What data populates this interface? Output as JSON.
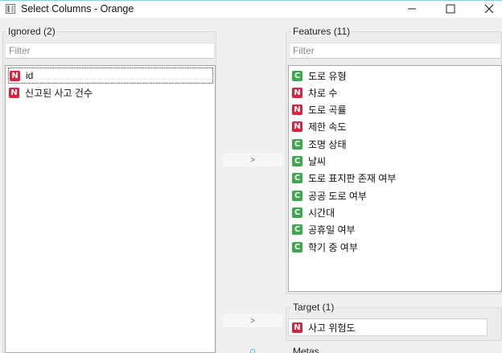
{
  "window": {
    "title": "Select Columns - Orange",
    "minimize_icon": "minimize-icon",
    "maximize_icon": "maximize-icon",
    "close_icon": "close-icon"
  },
  "ignored": {
    "title": "Ignored (2)",
    "filter_placeholder": "Filter",
    "items": [
      {
        "type": "N",
        "label": "id"
      },
      {
        "type": "N",
        "label": "신고된 사고 건수"
      }
    ]
  },
  "features": {
    "title": "Features (11)",
    "filter_placeholder": "Filter",
    "items": [
      {
        "type": "C",
        "label": "도로 유형"
      },
      {
        "type": "N",
        "label": "차로 수"
      },
      {
        "type": "N",
        "label": "도로 곡률"
      },
      {
        "type": "N",
        "label": "제한 속도"
      },
      {
        "type": "C",
        "label": "조명 상태"
      },
      {
        "type": "C",
        "label": "날씨"
      },
      {
        "type": "C",
        "label": "도로 표지판 존재 여부"
      },
      {
        "type": "C",
        "label": "공공 도로 여부"
      },
      {
        "type": "C",
        "label": "시간대"
      },
      {
        "type": "C",
        "label": "공휴일 여부"
      },
      {
        "type": "C",
        "label": "학기 중 여부"
      }
    ]
  },
  "target": {
    "title": "Target (1)",
    "items": [
      {
        "type": "N",
        "label": "사고 위험도"
      }
    ]
  },
  "metas": {
    "title": "Metas"
  },
  "buttons": {
    "move_features": ">",
    "move_target": ">"
  },
  "colors": {
    "numeric_badge": "#d8243e",
    "categorical_badge": "#3fa74d"
  }
}
